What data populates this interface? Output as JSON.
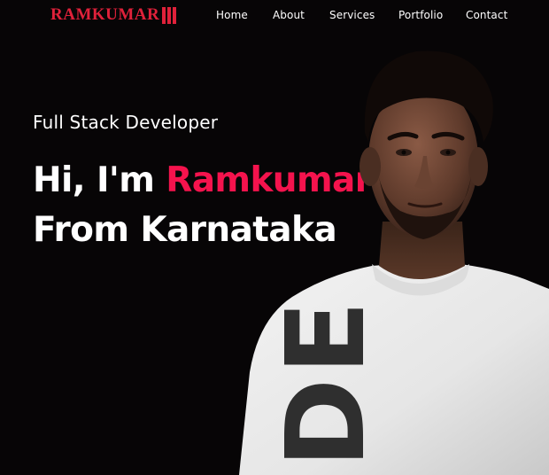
{
  "brand": {
    "logo_text": "RAMKUMAR"
  },
  "nav": {
    "items": [
      {
        "label": "Home"
      },
      {
        "label": "About"
      },
      {
        "label": "Services"
      },
      {
        "label": "Portfolio"
      },
      {
        "label": "Contact"
      }
    ]
  },
  "hero": {
    "subtitle": "Full Stack Developer",
    "greeting_prefix": "Hi, I'm ",
    "name": "Ramkumar",
    "location_line": "From Karnataka",
    "shirt_text": "DE"
  },
  "colors": {
    "accent": "#f5134d",
    "logo": "#e0213a",
    "background": "#070506",
    "text": "#ffffff"
  }
}
